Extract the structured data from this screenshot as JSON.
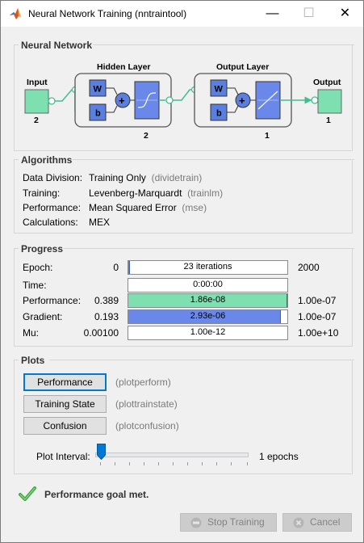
{
  "window": {
    "title": "Neural Network Training (nntraintool)",
    "app_icon": "matlab-logo-icon",
    "minimize_glyph": "—",
    "maximize_glyph": "☐",
    "close_glyph": "✕"
  },
  "network": {
    "section_title": "Neural Network",
    "input_label": "Input",
    "input_size": "2",
    "hidden_title": "Hidden Layer",
    "hidden_size": "2",
    "output_title": "Output Layer",
    "output_size": "1",
    "output_label": "Output",
    "weight_symbol": "W",
    "bias_symbol": "b",
    "sum_symbol": "+"
  },
  "algorithms": {
    "section_title": "Algorithms",
    "rows": [
      {
        "label": "Data Division:",
        "value": "Training Only",
        "fn": "(dividetrain)"
      },
      {
        "label": "Training:",
        "value": "Levenberg-Marquardt",
        "fn": "(trainlm)"
      },
      {
        "label": "Performance:",
        "value": "Mean Squared Error",
        "fn": "(mse)"
      },
      {
        "label": "Calculations:",
        "value": "MEX",
        "fn": ""
      }
    ]
  },
  "progress": {
    "section_title": "Progress",
    "rows": [
      {
        "label": "Epoch:",
        "start": "0",
        "current": "23 iterations",
        "end": "2000",
        "fill_fraction": 0.0115,
        "fill_color": "#5b7fde"
      },
      {
        "label": "Time:",
        "start": "",
        "current": "0:00:00",
        "end": "",
        "fill_fraction": 0,
        "fill_color": "#5b7fde"
      },
      {
        "label": "Performance:",
        "start": "0.389",
        "current": "1.86e-08",
        "end": "1.00e-07",
        "fill_fraction": 1.0,
        "fill_color": "#7ee0b0"
      },
      {
        "label": "Gradient:",
        "start": "0.193",
        "current": "2.93e-06",
        "end": "1.00e-07",
        "fill_fraction": 0.96,
        "fill_color": "#6a88ea"
      },
      {
        "label": "Mu:",
        "start": "0.00100",
        "current": "1.00e-12",
        "end": "1.00e+10",
        "fill_fraction": 0,
        "fill_color": "#5b7fde"
      }
    ]
  },
  "plots": {
    "section_title": "Plots",
    "buttons": [
      {
        "label": "Performance",
        "fn": "(plotperform)"
      },
      {
        "label": "Training State",
        "fn": "(plottrainstate)"
      },
      {
        "label": "Confusion",
        "fn": "(plotconfusion)"
      }
    ],
    "interval_label": "Plot Interval:",
    "interval_value": "1 epochs"
  },
  "status": {
    "icon": "checkmark-icon",
    "message": "Performance goal met."
  },
  "actions": {
    "stop_label": "Stop Training",
    "cancel_label": "Cancel"
  },
  "colors": {
    "node_green": "#7ee0b0",
    "transfer_blue": "#6a88ea",
    "check_green": "#3aa23a"
  }
}
